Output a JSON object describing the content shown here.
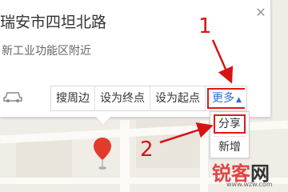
{
  "place": {
    "title": "瑞安市四坦北路",
    "address": "新工业功能区附近"
  },
  "actions": {
    "search_nearby": "搜周边",
    "set_destination": "设为终点",
    "set_origin": "设为起点",
    "more": "更多"
  },
  "more_menu": {
    "share": "分享",
    "add": "新增"
  },
  "callouts": {
    "step1": "1",
    "step2": "2"
  },
  "watermark": {
    "brand_red": "锐客",
    "brand_dark": "网",
    "url": "www.wzw.com"
  },
  "colors": {
    "highlight": "#e01818",
    "link_blue": "#2a6fd6",
    "pin_red": "#e23b2a"
  },
  "icons": {
    "close": "close-icon",
    "car": "car-icon",
    "caret": "caret-up-icon",
    "pin": "map-pin-icon"
  }
}
